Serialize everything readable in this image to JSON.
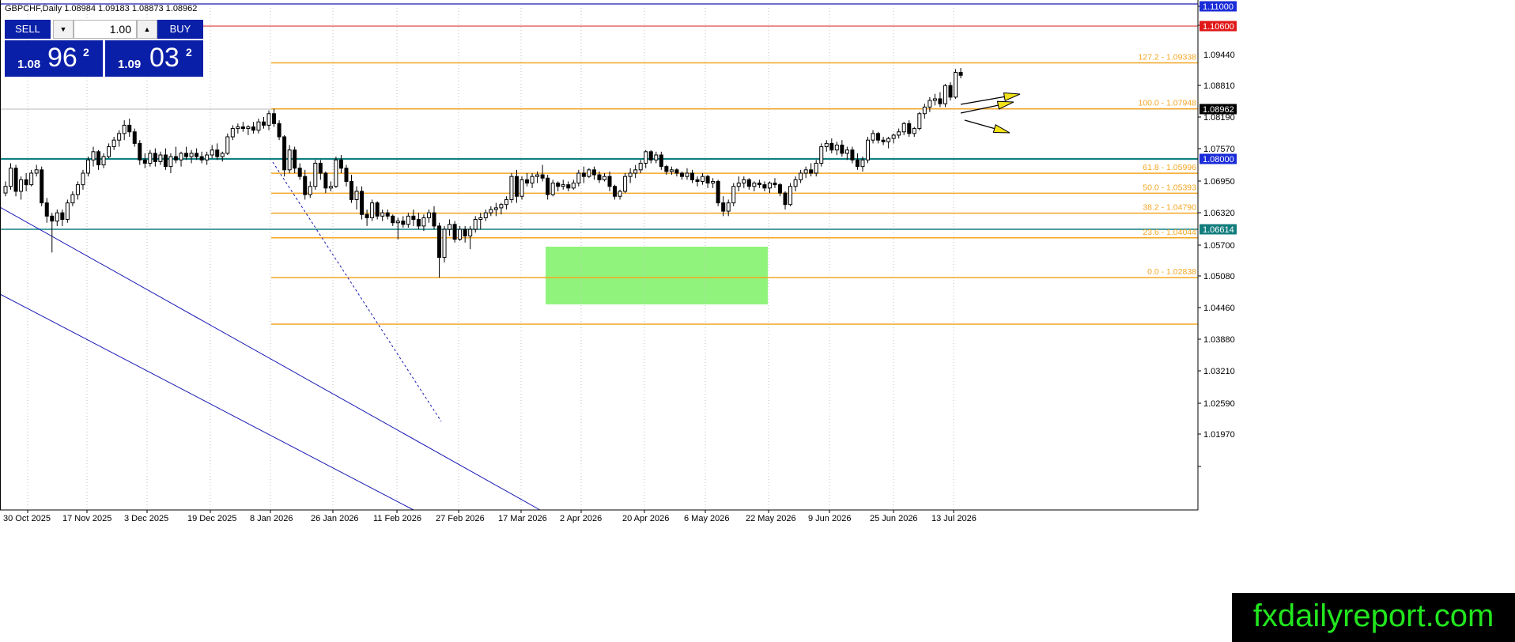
{
  "header": {
    "symbol": "GBPCHF,Daily",
    "ohlc": "1.08984 1.09183 1.08873 1.08962"
  },
  "trade_panel": {
    "sell_label": "SELL",
    "buy_label": "BUY",
    "volume": "1.00",
    "bid": {
      "prefix": "1.08",
      "big": "96",
      "sup": "2"
    },
    "ask": {
      "prefix": "1.09",
      "big": "03",
      "sup": "2"
    }
  },
  "watermark": "fxdailyreport.com",
  "colors": {
    "background": "#ffffff",
    "axis": "#000000",
    "grid_dot": "#c0c0c0",
    "fib": "#f5a623",
    "teal": "#117f82",
    "red_line": "#d81e1e",
    "channel": "#1a1ab5",
    "range_box": "#90f47c",
    "bull": "#ffffff",
    "bear": "#000000",
    "badge_blue": "#1a2bd8",
    "badge_red": "#e01818",
    "badge_teal": "#127d7d",
    "badge_black": "#000000",
    "arrow_fill": "#f2e21b"
  },
  "icons": {
    "sell_down": "triangle-down-icon",
    "buy_up": "triangle-up-icon"
  },
  "chart_data": {
    "type": "candlestick",
    "symbol": "GBPCHF",
    "timeframe": "Daily",
    "y_axis_ticks": [
      "1.11000",
      "1.10600",
      "1.09440",
      "1.08810",
      "1.08190",
      "1.07570",
      "1.06950",
      "1.06320",
      "1.05700",
      "1.05080",
      "1.04460",
      "1.03880",
      "1.03210",
      "1.02590",
      "1.01970"
    ],
    "x_axis_labels": [
      "30 Oct 2025",
      "17 Nov 2025",
      "3 Dec 2025",
      "19 Dec 2025",
      "8 Jan 2026",
      "26 Jan 2026",
      "11 Feb 2026",
      "27 Feb 2026",
      "17 Mar 2026",
      "2 Apr 2026",
      "20 Apr 2026",
      "6 May 2026",
      "22 May 2026",
      "9 Jun 2026",
      "25 Jun 2026",
      "13 Jul 2026"
    ],
    "price_badges": [
      {
        "label": "1.11000",
        "color": "badge_blue",
        "value": 1.11
      },
      {
        "label": "1.10600",
        "color": "badge_red",
        "value": 1.106
      },
      {
        "label": "1.08962",
        "color": "badge_black",
        "value": 1.08962
      },
      {
        "label": "1.08000",
        "color": "badge_blue",
        "value": 1.08
      },
      {
        "label": "1.06614",
        "color": "badge_teal",
        "value": 1.06614
      }
    ],
    "fib_levels": [
      {
        "label": "127.2 - 1.09338",
        "value": 1.09338
      },
      {
        "label": "100.0 - 1.07948",
        "value": 1.07948
      },
      {
        "label": "61.8 - 1.05996",
        "value": 1.05996
      },
      {
        "label": "50.0 - 1.05393",
        "value": 1.05393
      },
      {
        "label": "38.2 - 1.04790",
        "value": 1.0479
      },
      {
        "label": "23.6 - 1.04044",
        "value": 1.04044
      },
      {
        "label": "0.0 - 1.02838",
        "value": 1.02838
      },
      {
        "label": "",
        "value": 1.0143
      }
    ],
    "candles": [
      [
        1.054,
        1.0575,
        1.053,
        1.056
      ],
      [
        1.056,
        1.063,
        1.055,
        1.0615
      ],
      [
        1.0615,
        1.0625,
        1.053,
        1.0545
      ],
      [
        1.0545,
        1.059,
        1.052,
        1.058
      ],
      [
        1.058,
        1.06,
        1.0545,
        1.0565
      ],
      [
        1.0565,
        1.061,
        1.056,
        1.06
      ],
      [
        1.06,
        1.0625,
        1.059,
        1.061
      ],
      [
        1.061,
        1.062,
        1.05,
        1.051
      ],
      [
        1.051,
        1.0525,
        1.045,
        1.047
      ],
      [
        1.047,
        1.048,
        1.036,
        1.0455
      ],
      [
        1.0455,
        1.049,
        1.044,
        1.048
      ],
      [
        1.048,
        1.049,
        1.044,
        1.046
      ],
      [
        1.046,
        1.052,
        1.045,
        1.051
      ],
      [
        1.051,
        1.0545,
        1.05,
        1.0535
      ],
      [
        1.0535,
        1.0575,
        1.052,
        1.0565
      ],
      [
        1.0565,
        1.061,
        1.055,
        1.06
      ],
      [
        1.06,
        1.065,
        1.059,
        1.064
      ],
      [
        1.064,
        1.068,
        1.062,
        1.0665
      ],
      [
        1.0665,
        1.067,
        1.061,
        1.0625
      ],
      [
        1.0625,
        1.066,
        1.0615,
        1.065
      ],
      [
        1.065,
        1.069,
        1.0645,
        1.068
      ],
      [
        1.068,
        1.071,
        1.067,
        1.07
      ],
      [
        1.07,
        1.073,
        1.068,
        1.072
      ],
      [
        1.072,
        1.076,
        1.07,
        1.0745
      ],
      [
        1.0745,
        1.0765,
        1.071,
        1.0725
      ],
      [
        1.0725,
        1.0735,
        1.068,
        1.069
      ],
      [
        1.069,
        1.07,
        1.0625,
        1.064
      ],
      [
        1.064,
        1.066,
        1.0615,
        1.063
      ],
      [
        1.063,
        1.067,
        1.062,
        1.066
      ],
      [
        1.066,
        1.0675,
        1.062,
        1.0635
      ],
      [
        1.0635,
        1.0665,
        1.0625,
        1.0655
      ],
      [
        1.0655,
        1.0675,
        1.061,
        1.062
      ],
      [
        1.062,
        1.066,
        1.06,
        1.065
      ],
      [
        1.065,
        1.068,
        1.063,
        1.064
      ],
      [
        1.064,
        1.0665,
        1.062,
        1.066
      ],
      [
        1.066,
        1.068,
        1.064,
        1.065
      ],
      [
        1.065,
        1.067,
        1.063,
        1.066
      ],
      [
        1.066,
        1.0675,
        1.064,
        1.065
      ],
      [
        1.065,
        1.0665,
        1.063,
        1.064
      ],
      [
        1.064,
        1.0665,
        1.0625,
        1.0655
      ],
      [
        1.0655,
        1.0685,
        1.0645,
        1.067
      ],
      [
        1.067,
        1.069,
        1.064,
        1.065
      ],
      [
        1.065,
        1.0665,
        1.0635,
        1.066
      ],
      [
        1.066,
        1.072,
        1.0655,
        1.071
      ],
      [
        1.071,
        1.0745,
        1.07,
        1.0735
      ],
      [
        1.0735,
        1.075,
        1.072,
        1.074
      ],
      [
        1.074,
        1.0755,
        1.0725,
        1.0735
      ],
      [
        1.0735,
        1.0745,
        1.0715,
        1.074
      ],
      [
        1.074,
        1.0755,
        1.072,
        1.073
      ],
      [
        1.073,
        1.0765,
        1.072,
        1.0755
      ],
      [
        1.0755,
        1.077,
        1.0735,
        1.0745
      ],
      [
        1.0745,
        1.079,
        1.073,
        1.078
      ],
      [
        1.078,
        1.0795,
        1.074,
        1.075
      ],
      [
        1.075,
        1.076,
        1.07,
        1.071
      ],
      [
        1.071,
        1.0715,
        1.059,
        1.061
      ],
      [
        1.061,
        1.0685,
        1.06,
        1.067
      ],
      [
        1.067,
        1.068,
        1.06,
        1.0615
      ],
      [
        1.0615,
        1.063,
        1.058,
        1.059
      ],
      [
        1.059,
        1.061,
        1.052,
        1.0535
      ],
      [
        1.0535,
        1.0575,
        1.0525,
        1.056
      ],
      [
        1.056,
        1.064,
        1.055,
        1.063
      ],
      [
        1.063,
        1.064,
        1.058,
        1.06
      ],
      [
        1.06,
        1.0605,
        1.054,
        1.0555
      ],
      [
        1.0555,
        1.0575,
        1.0545,
        1.056
      ],
      [
        1.056,
        1.065,
        1.0555,
        1.064
      ],
      [
        1.064,
        1.0655,
        1.06,
        1.0615
      ],
      [
        1.0615,
        1.0625,
        1.056,
        1.0575
      ],
      [
        1.0575,
        1.0595,
        1.051,
        1.052
      ],
      [
        1.052,
        1.056,
        1.049,
        1.0545
      ],
      [
        1.0545,
        1.056,
        1.046,
        1.0475
      ],
      [
        1.0475,
        1.049,
        1.044,
        1.0465
      ],
      [
        1.0465,
        1.052,
        1.0455,
        1.051
      ],
      [
        1.051,
        1.0515,
        1.046,
        1.047
      ],
      [
        1.047,
        1.049,
        1.0455,
        1.048
      ],
      [
        1.048,
        1.049,
        1.046,
        1.047
      ],
      [
        1.047,
        1.0475,
        1.044,
        1.045
      ],
      [
        1.045,
        1.0465,
        1.04,
        1.0455
      ],
      [
        1.0455,
        1.047,
        1.0435,
        1.0445
      ],
      [
        1.0445,
        1.048,
        1.0435,
        1.047
      ],
      [
        1.047,
        1.049,
        1.044,
        1.046
      ],
      [
        1.046,
        1.048,
        1.043,
        1.044
      ],
      [
        1.044,
        1.0475,
        1.0425,
        1.0465
      ],
      [
        1.0465,
        1.049,
        1.045,
        1.048
      ],
      [
        1.048,
        1.05,
        1.043,
        1.044
      ],
      [
        1.044,
        1.045,
        1.0284,
        1.0345
      ],
      [
        1.0345,
        1.044,
        1.033,
        1.043
      ],
      [
        1.043,
        1.046,
        1.041,
        1.0445
      ],
      [
        1.0445,
        1.0455,
        1.039,
        1.04
      ],
      [
        1.04,
        1.044,
        1.0395,
        1.043
      ],
      [
        1.043,
        1.044,
        1.039,
        1.041
      ],
      [
        1.041,
        1.044,
        1.037,
        1.043
      ],
      [
        1.043,
        1.047,
        1.042,
        1.046
      ],
      [
        1.046,
        1.048,
        1.043,
        1.0465
      ],
      [
        1.0465,
        1.049,
        1.0455,
        1.048
      ],
      [
        1.048,
        1.05,
        1.047,
        1.049
      ],
      [
        1.049,
        1.051,
        1.047,
        1.0495
      ],
      [
        1.0495,
        1.051,
        1.0475,
        1.0505
      ],
      [
        1.0505,
        1.053,
        1.049,
        1.052
      ],
      [
        1.052,
        1.06,
        1.051,
        1.059
      ],
      [
        1.059,
        1.061,
        1.051,
        1.053
      ],
      [
        1.053,
        1.059,
        1.052,
        1.058
      ],
      [
        1.058,
        1.06,
        1.056,
        1.057
      ],
      [
        1.057,
        1.06,
        1.0555,
        1.059
      ],
      [
        1.059,
        1.0605,
        1.057,
        1.0595
      ],
      [
        1.0595,
        1.0625,
        1.0575,
        1.0585
      ],
      [
        1.0585,
        1.0595,
        1.052,
        1.0535
      ],
      [
        1.0535,
        1.058,
        1.053,
        1.057
      ],
      [
        1.057,
        1.0575,
        1.0545,
        1.056
      ],
      [
        1.056,
        1.058,
        1.055,
        1.0565
      ],
      [
        1.0565,
        1.0575,
        1.0545,
        1.0555
      ],
      [
        1.0555,
        1.058,
        1.055,
        1.057
      ],
      [
        1.057,
        1.061,
        1.056,
        1.06
      ],
      [
        1.06,
        1.062,
        1.057,
        1.059
      ],
      [
        1.059,
        1.0615,
        1.0585,
        1.061
      ],
      [
        1.061,
        1.062,
        1.058,
        1.0595
      ],
      [
        1.0595,
        1.0605,
        1.057,
        1.058
      ],
      [
        1.058,
        1.06,
        1.0575,
        1.059
      ],
      [
        1.059,
        1.0605,
        1.0545,
        1.056
      ],
      [
        1.056,
        1.0565,
        1.052,
        1.053
      ],
      [
        1.053,
        1.055,
        1.052,
        1.0545
      ],
      [
        1.0545,
        1.06,
        1.054,
        1.059
      ],
      [
        1.059,
        1.0615,
        1.057,
        1.06
      ],
      [
        1.06,
        1.0625,
        1.0585,
        1.061
      ],
      [
        1.061,
        1.064,
        1.06,
        1.063
      ],
      [
        1.063,
        1.067,
        1.0615,
        1.0665
      ],
      [
        1.0665,
        1.067,
        1.063,
        1.064
      ],
      [
        1.064,
        1.0665,
        1.063,
        1.0655
      ],
      [
        1.0655,
        1.0665,
        1.061,
        1.062
      ],
      [
        1.062,
        1.0625,
        1.0595,
        1.0605
      ],
      [
        1.0605,
        1.062,
        1.0595,
        1.061
      ],
      [
        1.061,
        1.0615,
        1.059,
        1.06
      ],
      [
        1.06,
        1.0605,
        1.058,
        1.059
      ],
      [
        1.059,
        1.0615,
        1.058,
        1.06
      ],
      [
        1.06,
        1.061,
        1.057,
        1.058
      ],
      [
        1.058,
        1.059,
        1.056,
        1.0575
      ],
      [
        1.0575,
        1.06,
        1.0565,
        1.059
      ],
      [
        1.059,
        1.0595,
        1.0555,
        1.057
      ],
      [
        1.057,
        1.0585,
        1.0555,
        1.0575
      ],
      [
        1.0575,
        1.058,
        1.05,
        1.051
      ],
      [
        1.051,
        1.053,
        1.047,
        1.0485
      ],
      [
        1.0485,
        1.052,
        1.047,
        1.051
      ],
      [
        1.051,
        1.057,
        1.05,
        1.056
      ],
      [
        1.056,
        1.059,
        1.0545,
        1.057
      ],
      [
        1.057,
        1.059,
        1.0555,
        1.058
      ],
      [
        1.058,
        1.0585,
        1.055,
        1.056
      ],
      [
        1.056,
        1.0575,
        1.0545,
        1.057
      ],
      [
        1.057,
        1.058,
        1.0555,
        1.0565
      ],
      [
        1.0565,
        1.0575,
        1.0545,
        1.0555
      ],
      [
        1.0555,
        1.0575,
        1.054,
        1.057
      ],
      [
        1.057,
        1.0585,
        1.0555,
        1.0565
      ],
      [
        1.0565,
        1.057,
        1.053,
        1.054
      ],
      [
        1.054,
        1.0545,
        1.049,
        1.0505
      ],
      [
        1.0505,
        1.057,
        1.05,
        1.056
      ],
      [
        1.056,
        1.059,
        1.0545,
        1.058
      ],
      [
        1.058,
        1.061,
        1.057,
        1.06
      ],
      [
        1.06,
        1.062,
        1.0585,
        1.061
      ],
      [
        1.061,
        1.063,
        1.059,
        1.06
      ],
      [
        1.06,
        1.064,
        1.059,
        1.063
      ],
      [
        1.063,
        1.069,
        1.062,
        1.068
      ],
      [
        1.068,
        1.07,
        1.0665,
        1.069
      ],
      [
        1.069,
        1.0705,
        1.066,
        1.067
      ],
      [
        1.067,
        1.0695,
        1.0655,
        1.0685
      ],
      [
        1.0685,
        1.07,
        1.065,
        1.066
      ],
      [
        1.066,
        1.068,
        1.064,
        1.067
      ],
      [
        1.067,
        1.068,
        1.063,
        1.064
      ],
      [
        1.064,
        1.066,
        1.061,
        1.062
      ],
      [
        1.062,
        1.065,
        1.0605,
        1.064
      ],
      [
        1.064,
        1.071,
        1.063,
        1.07
      ],
      [
        1.07,
        1.073,
        1.069,
        1.072
      ],
      [
        1.072,
        1.0725,
        1.069,
        1.07
      ],
      [
        1.07,
        1.071,
        1.0685,
        1.0695
      ],
      [
        1.0695,
        1.071,
        1.0675,
        1.0705
      ],
      [
        1.0705,
        1.072,
        1.069,
        1.0715
      ],
      [
        1.0715,
        1.0735,
        1.0705,
        1.0725
      ],
      [
        1.0725,
        1.0755,
        1.0715,
        1.075
      ],
      [
        1.075,
        1.076,
        1.071,
        1.072
      ],
      [
        1.072,
        1.074,
        1.071,
        1.0735
      ],
      [
        1.0735,
        1.0785,
        1.073,
        1.078
      ],
      [
        1.078,
        1.081,
        1.0765,
        1.08
      ],
      [
        1.08,
        1.083,
        1.0785,
        1.082
      ],
      [
        1.082,
        1.084,
        1.0805,
        1.0825
      ],
      [
        1.0825,
        1.0845,
        1.08,
        1.081
      ],
      [
        1.081,
        1.087,
        1.08,
        1.0865
      ],
      [
        1.0865,
        1.0875,
        1.082,
        1.083
      ],
      [
        1.083,
        1.0915,
        1.0825,
        1.0905
      ],
      [
        1.0905,
        1.0918,
        1.0887,
        1.0896
      ]
    ]
  }
}
